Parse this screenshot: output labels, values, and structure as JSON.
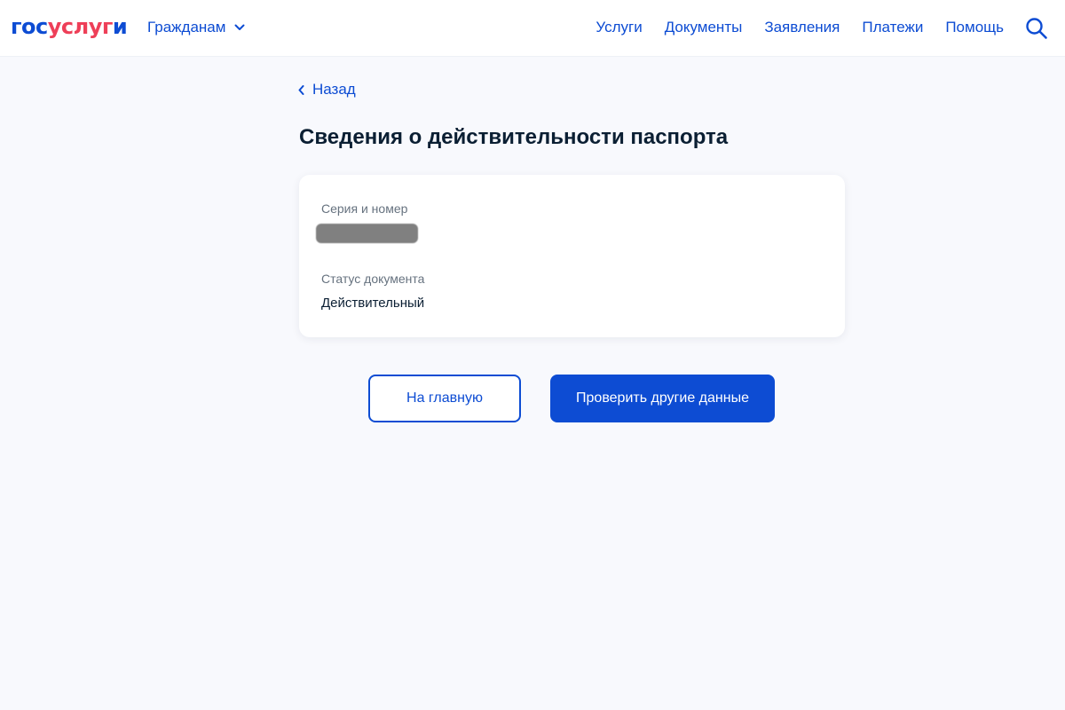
{
  "header": {
    "logo": {
      "part1": "гос",
      "part2": "услуг",
      "part3": "и"
    },
    "audience_label": "Гражданам",
    "nav": [
      "Услуги",
      "Документы",
      "Заявления",
      "Платежи",
      "Помощь"
    ]
  },
  "back_label": "Назад",
  "page_title": "Сведения о действительности паспорта",
  "card": {
    "series_label": "Серия и номер",
    "status_label": "Статус документа",
    "status_value": "Действительный"
  },
  "buttons": {
    "home": "На главную",
    "check_other": "Проверить другие данные"
  },
  "colors": {
    "accent": "#0d4cd3",
    "brand_red": "#ee3f58",
    "background": "#f8f9fd"
  },
  "icons": {
    "audience_dropdown": "chevron-down-icon",
    "search": "search-icon",
    "back": "chevron-left-icon"
  }
}
